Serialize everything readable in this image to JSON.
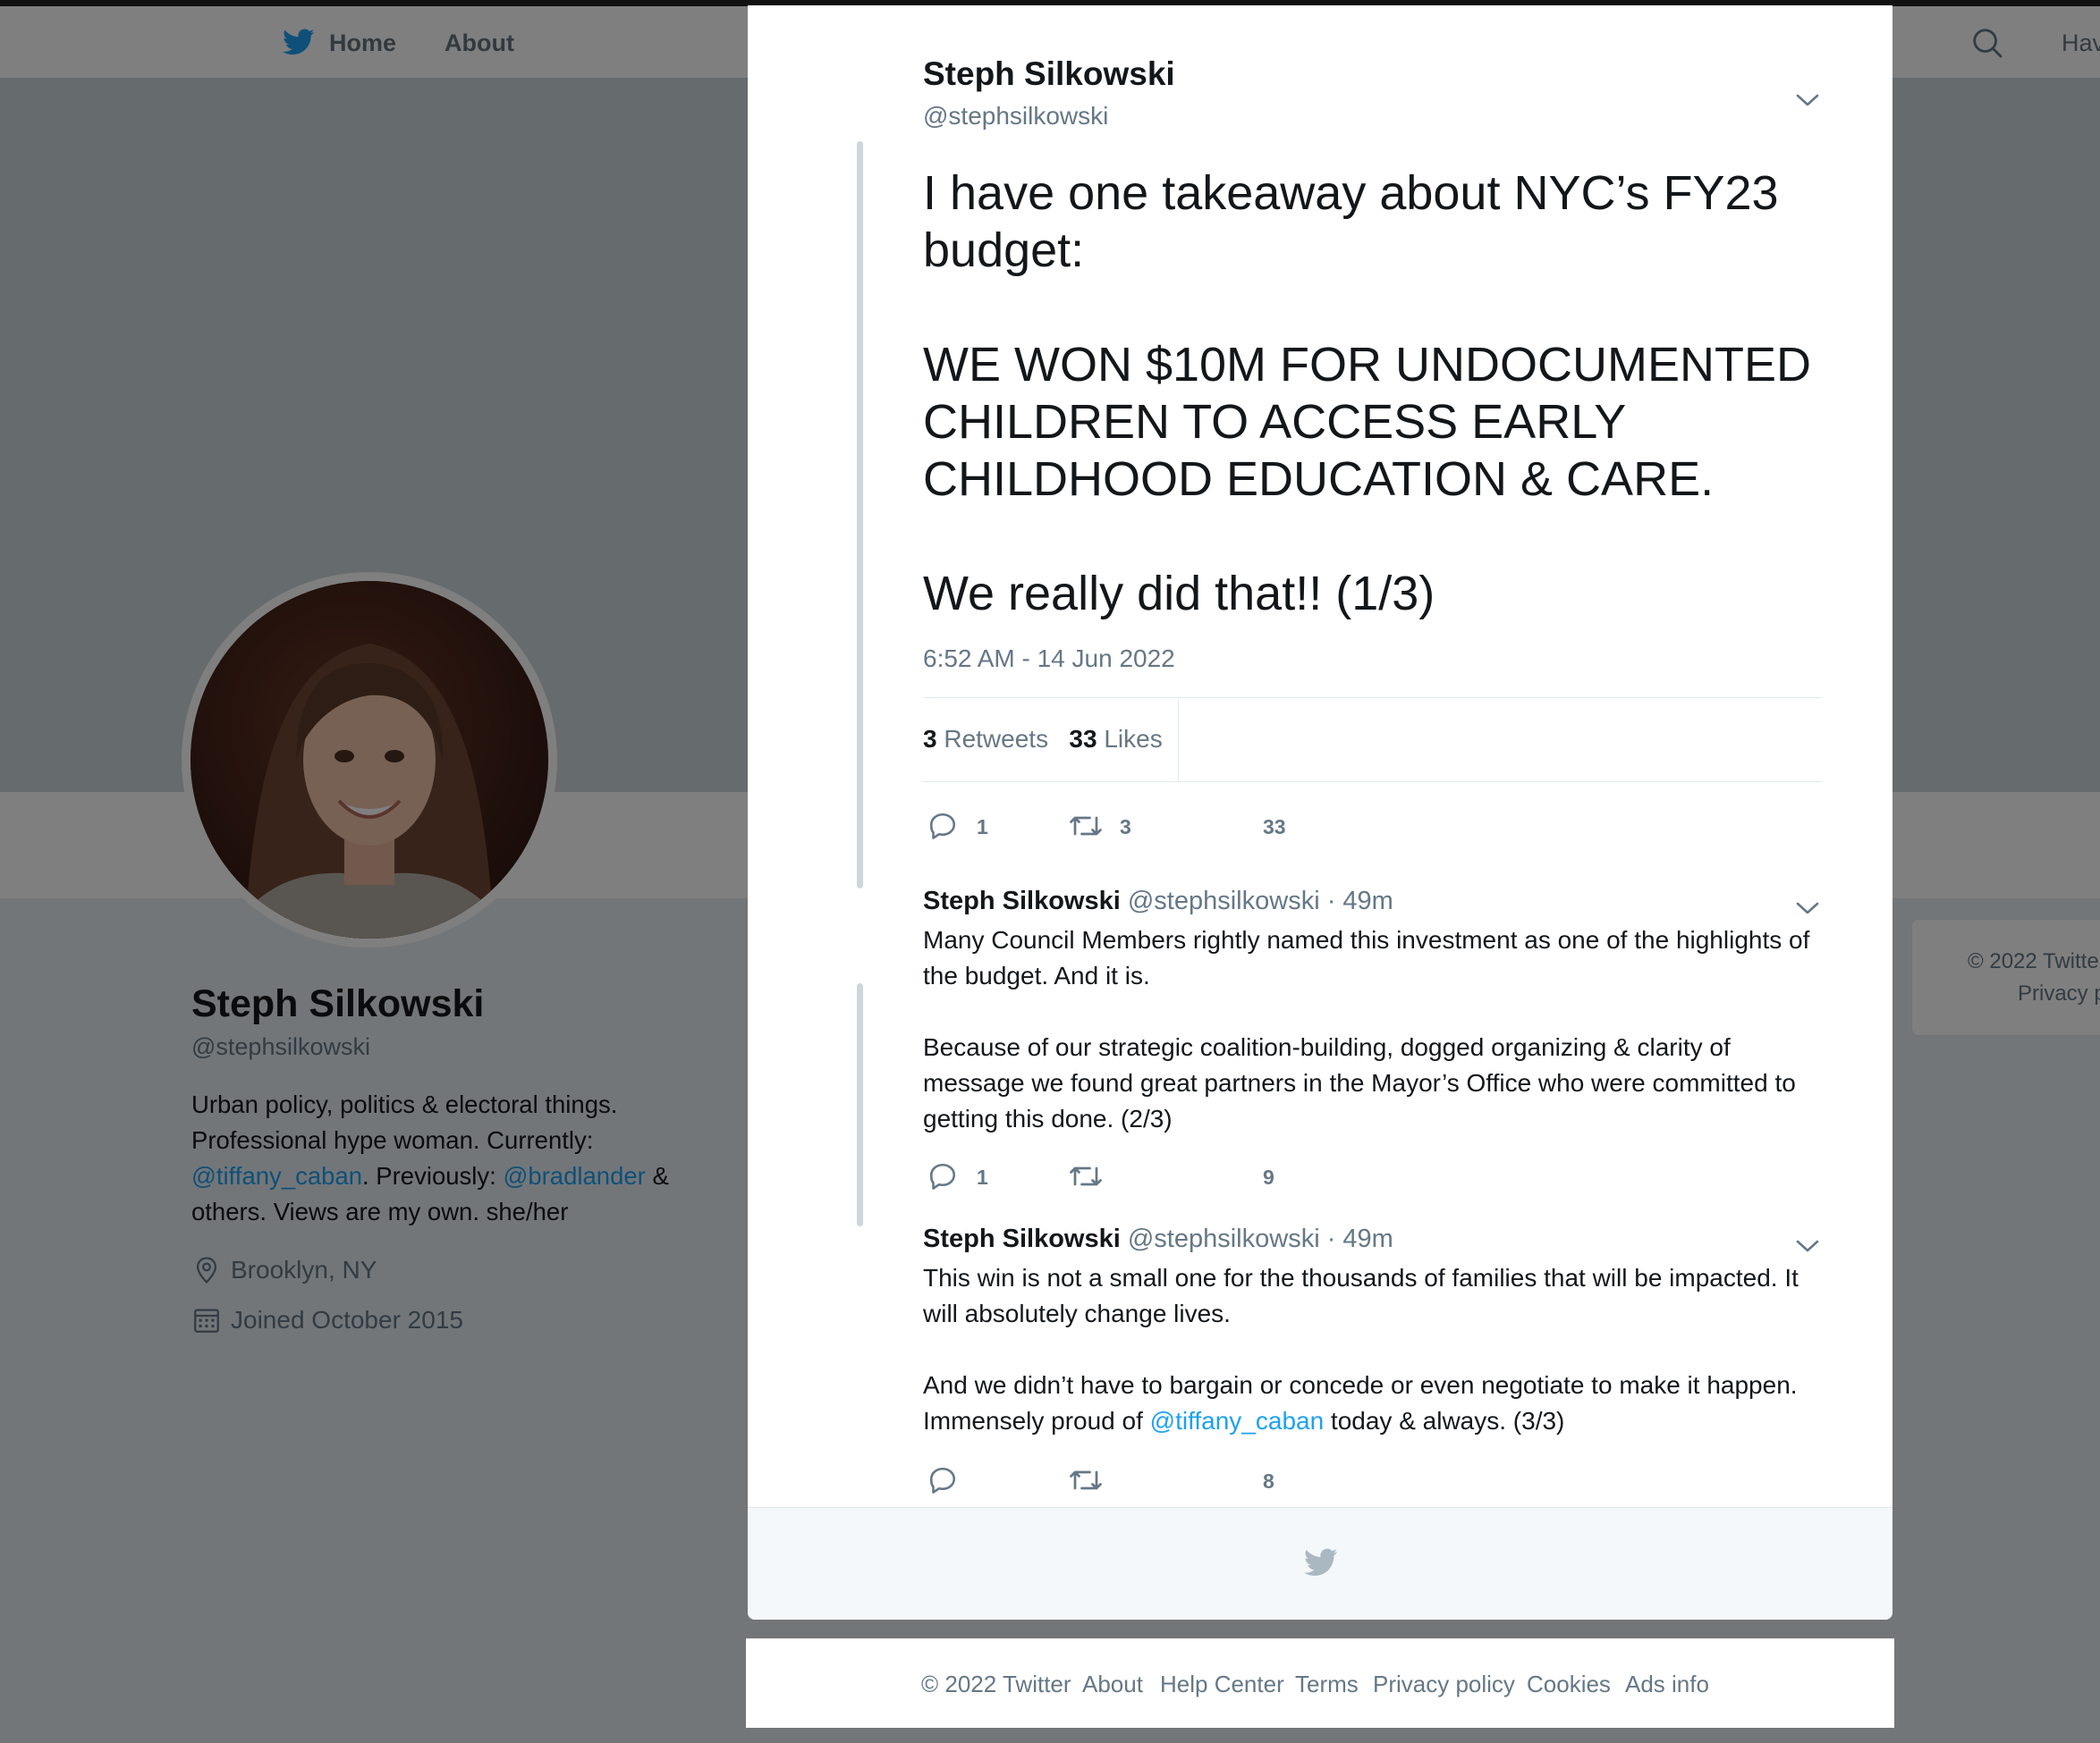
{
  "nav": {
    "home_label": "Home",
    "about_label": "About",
    "search_partial": "Hav"
  },
  "profile": {
    "name": "Steph Silkowski",
    "handle": "@stephsilkowski",
    "bio_1": "Urban policy, politics & electoral things. Professional hype woman. Currently: ",
    "bio_mention_1": "@tiffany_caban",
    "bio_2": ". Previously: ",
    "bio_mention_2": "@bradlander",
    "bio_3": " & others. Views are my own. she/her",
    "location": "Brooklyn, NY",
    "joined": "Joined October 2015"
  },
  "side_card": {
    "copyright": "© 2022 Twitte",
    "privacy": "Privacy p"
  },
  "main_tweet": {
    "author_name": "Steph Silkowski",
    "author_handle": "@stephsilkowski",
    "text": "I have one takeaway about NYC’s FY23 budget:\n\nWE WON $10M FOR UNDOCUMENTED CHILDREN TO ACCESS EARLY CHILDHOOD EDUCATION & CARE.\n\nWe really did that!! (1/3)",
    "timestamp": "6:52 AM - 14 Jun 2022",
    "retweets_count": "3",
    "retweets_label": "Retweets",
    "likes_count": "33",
    "likes_label": "Likes",
    "reply_count": "1",
    "retweet_action_count": "3",
    "like_action_count": "33"
  },
  "replies": [
    {
      "name": "Steph Silkowski",
      "meta": "@stephsilkowski · 49m",
      "text": "Many Council Members rightly named this investment as one of the highlights of the budget. And it is.\n\nBecause of our strategic coalition-building, dogged organizing & clarity of message we found great partners in the Mayor’s Office who were committed to getting this done. (2/3)",
      "reply_count": "1",
      "like_count": "9"
    },
    {
      "name": "Steph Silkowski",
      "meta": "@stephsilkowski · 49m",
      "text_1": "This win is not a small one for the thousands of families that will be impacted. It will absolutely change lives.\n\nAnd we didn’t have to bargain or concede or even negotiate to make it happen. Immensely proud of ",
      "mention": "@tiffany_caban",
      "text_2": " today & always. (3/3)",
      "like_count": "8"
    }
  ],
  "footer": {
    "copyright": "© 2022 Twitter",
    "about": "About",
    "help": "Help Center",
    "terms": "Terms",
    "privacy": "Privacy policy",
    "cookies": "Cookies",
    "ads": "Ads info"
  },
  "colors": {
    "accent": "#1da1f2",
    "text_primary": "#14171a",
    "text_secondary": "#657786"
  }
}
